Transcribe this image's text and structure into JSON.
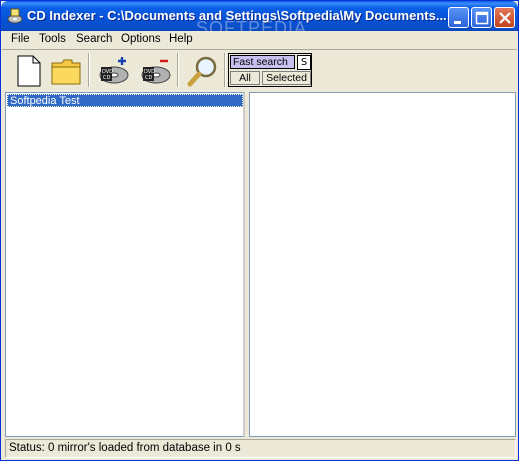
{
  "window": {
    "title": "CD Indexer - C:\\Documents and Settings\\Softpedia\\My Documents...",
    "watermark": "SOFTPEDIA",
    "buttons": [
      "minimize",
      "maximize",
      "close"
    ]
  },
  "menubar": {
    "items": [
      "File",
      "Tools",
      "Search",
      "Options",
      "Help"
    ]
  },
  "toolbar": {
    "icons": [
      "new-document-icon",
      "open-folder-icon",
      "add-disc-icon",
      "remove-disc-icon",
      "search-magnifier-icon"
    ],
    "disc_label": "DVD CD",
    "search": {
      "input_value": "Fast search",
      "s_button": "S",
      "option_all": "All",
      "option_selected": "Selected"
    }
  },
  "tree": {
    "items": [
      "Softpedia Test"
    ]
  },
  "status": {
    "text": "Status: 0 mirror's loaded from database in 0 s"
  },
  "colors": {
    "titlebar": "#0a5fe8",
    "selection": "#316ac5",
    "search_input_bg": "#c8c0f0",
    "window_bg": "#ece9d8"
  }
}
